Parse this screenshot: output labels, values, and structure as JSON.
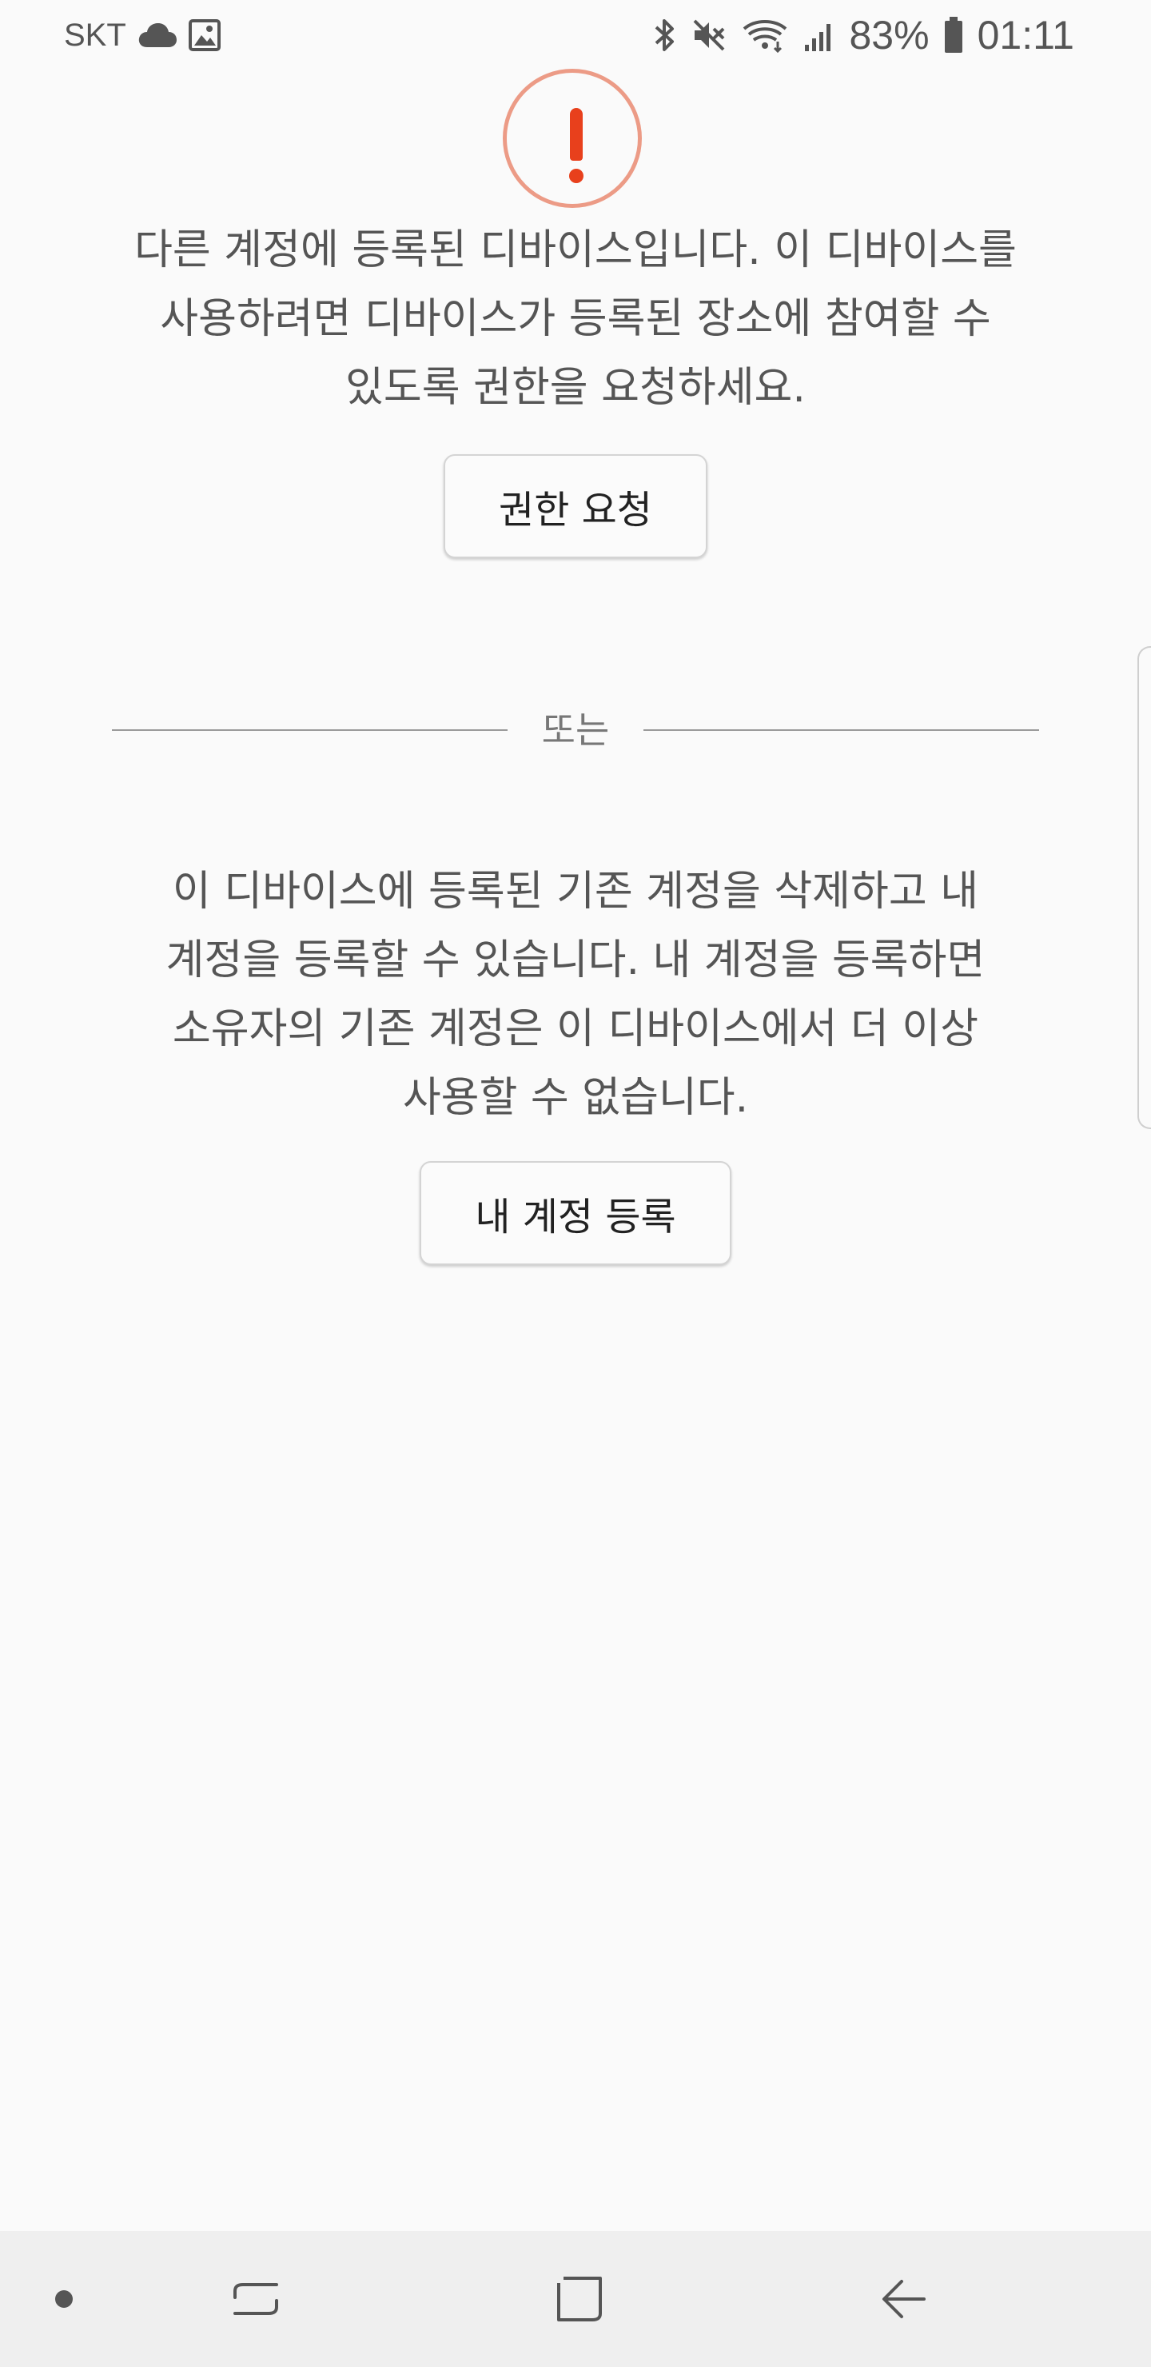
{
  "status_bar": {
    "carrier": "SKT",
    "battery": "83%",
    "time": "01:11",
    "icons": [
      "cloud-icon",
      "image-icon",
      "bluetooth-icon",
      "mute-icon",
      "wifi-icon",
      "signal-icon",
      "battery-icon"
    ]
  },
  "main": {
    "message_1": [
      "다른 계정에 등록된 디바이스입니다. 이 디바이스를",
      "사용하려면 디바이스가 등록된 장소에 참여할 수",
      "있도록 권한을 요청하세요."
    ],
    "request_button": "권한 요청",
    "divider_label": "또는",
    "message_2": [
      "이 디바이스에 등록된 기존 계정을 삭제하고 내",
      "계정을 등록할 수 있습니다. 내 계정을 등록하면",
      "소유자의 기존 계정은 이 디바이스에서 더 이상",
      "사용할 수 없습니다."
    ],
    "register_button": "내 계정 등록"
  },
  "nav_bar": {
    "icons": [
      "dot-icon",
      "recents-icon",
      "home-icon",
      "back-icon"
    ]
  },
  "colors": {
    "background": "#fafafa",
    "warning_accent": "#e8401c",
    "warning_ring": "#ec9b86",
    "text": "#555555",
    "nav_background": "#efefef"
  }
}
